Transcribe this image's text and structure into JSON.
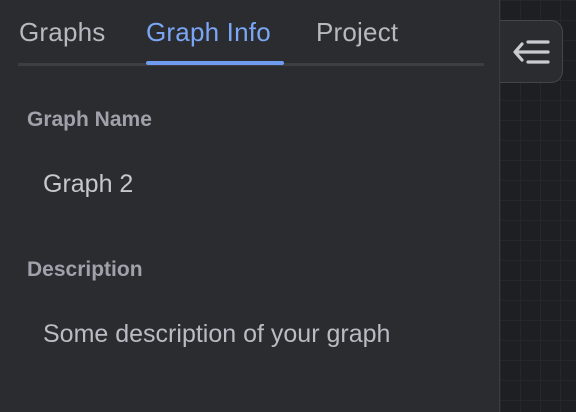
{
  "tabs": [
    {
      "label": "Graphs",
      "active": false
    },
    {
      "label": "Graph Info",
      "active": true
    },
    {
      "label": "Project",
      "active": false
    }
  ],
  "graph_info": {
    "name_label": "Graph Name",
    "name_value": "Graph 2",
    "description_label": "Description",
    "description_placeholder": "Some description of your graph",
    "description_value": ""
  },
  "sidebar_toggle": {
    "icon": "collapse-panel-icon"
  },
  "colors": {
    "accent": "#7aa6f5",
    "panel_bg": "#2b2c30",
    "canvas_bg": "#1e1f22"
  }
}
